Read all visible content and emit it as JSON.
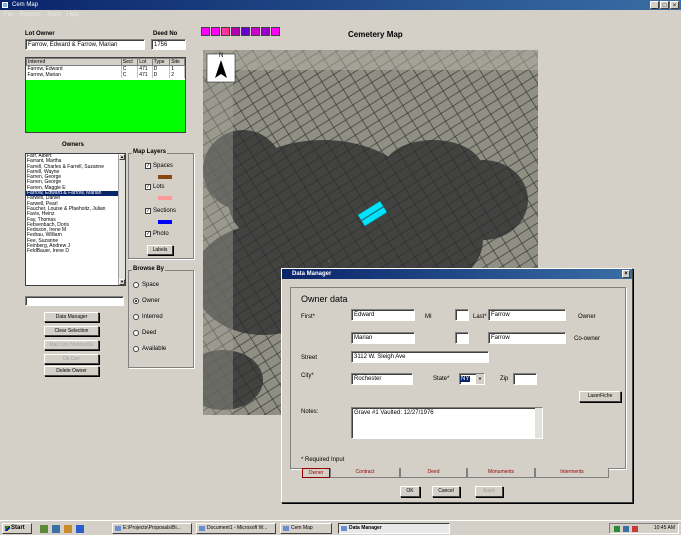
{
  "window": {
    "title": "Cem Map",
    "menu": [
      "File",
      "Reports",
      "Tools",
      "Help"
    ]
  },
  "lot_owner": {
    "label": "Lot Owner",
    "value": "Farrow, Edward & Farrow, Marian"
  },
  "deed_no": {
    "label": "Deed No",
    "value": "1756"
  },
  "interred_table": {
    "headers": [
      "Interred",
      "Sect",
      "Lot",
      "Type",
      "Site"
    ],
    "rows": [
      [
        "Farrow, Edward",
        "C",
        "471",
        "D",
        "1"
      ],
      [
        "Farrow, Marian",
        "C",
        "471",
        "D",
        "2"
      ]
    ]
  },
  "owners": {
    "label": "Owners",
    "items": [
      "Farr, Albert",
      "Farrant, Martha",
      "Farrell, Charles & Farrell, Suzanne",
      "Farrell, Wayne",
      "Farren, George",
      "Farren, George",
      "Farren, Maggie E",
      "Farrow, Edward & Farrow, Marian",
      "Farwell, Daniel",
      "Farwell, Pearl",
      "Faucher, Louise & Pfaehoitz, Julian",
      "Favis, Heinz",
      "Fay, Thomas",
      "Febvenbach, Doris",
      "Fedoson, Irene M",
      "Fedrau, William",
      "Fee, Suzanne",
      "Feinberg, Andrew J",
      "FeldBauer, Irene D"
    ],
    "selected_index": 7
  },
  "search_input": {
    "value": ""
  },
  "left_buttons": {
    "data_manager": "Data Manager",
    "clear_selection": "Clear Selection",
    "mail_list": "Mail List (Vendor/Gr",
    "ok": "Ok Cen",
    "delete_owner": "Delete Owner"
  },
  "map_layers": {
    "label": "Map Layers",
    "spaces": {
      "label": "Spaces",
      "color": "#8b4513"
    },
    "lots": {
      "label": "Lots",
      "color": "#ff9999"
    },
    "sections": {
      "label": "Sections",
      "color": "#0000ff"
    },
    "photo": {
      "label": "Photo"
    },
    "labels_button": "Labels"
  },
  "browse_by": {
    "label": "Browse By",
    "options": [
      "Space",
      "Owner",
      "Interred",
      "Deed",
      "Available"
    ],
    "selected": "Owner"
  },
  "map": {
    "title": "Cemetery Map",
    "north_label": "N",
    "highlight_color": "#00e5ff"
  },
  "toolbar_colors": [
    "#ff00ff",
    "#ff00ff",
    "#ff3399",
    "#b000b0",
    "#6600cc",
    "#cc00cc",
    "#9900cc",
    "#ff00ff"
  ],
  "data_manager": {
    "title": "Data Manager",
    "heading": "Owner data",
    "first_label": "First*",
    "mi_label": "MI",
    "last_label": "Last*",
    "first_value": "Edward",
    "last_value": "Farrow",
    "owner_role": "Owner",
    "co_first": "Marian",
    "co_last": "Farrow",
    "co_role": "Co-owner",
    "street_label": "Street",
    "street_value": "3112 W. Sleigh Ave",
    "city_label": "City*",
    "city_value": "Rochester",
    "state_label": "State*",
    "state_value": "NY",
    "zip_label": "Zip",
    "laserfiche": "LaserFiche",
    "notes_label": "Notes:",
    "notes_value": "Grave #1 Vaulted: 12/27/1976",
    "required": "* Required Input",
    "tabs": [
      "Owner",
      "Contract",
      "Deed",
      "Monuments",
      "Interments"
    ],
    "ok": "OK",
    "cancel": "Cancel",
    "apply": "Apply"
  },
  "taskbar": {
    "start": "Start",
    "tasks": [
      "E:\\Projects\\Proposals\\Bi...",
      "Document1 - Microsoft W...",
      "Cem Map",
      "Data Manager"
    ],
    "clock": "10:45 AM"
  }
}
